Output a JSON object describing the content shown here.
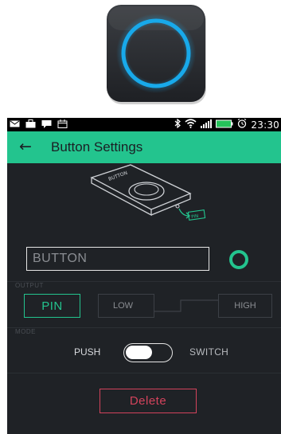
{
  "app_icon": {
    "icon": "blynk-button-ring-icon"
  },
  "status_bar": {
    "time": "23:30",
    "icons": [
      "email-icon",
      "briefcase-icon",
      "chat-icon",
      "calendar-icon",
      "bluetooth-icon",
      "wifi-icon",
      "signal-icon",
      "battery-icon",
      "alarm-icon"
    ]
  },
  "app_bar": {
    "back_icon": "←",
    "title": "Button Settings"
  },
  "preview": {
    "button_text": "BUTTON",
    "pin_text": "PIN"
  },
  "name_field": {
    "value": "BUTTON"
  },
  "output": {
    "label": "OUTPUT",
    "pin_button": "PIN",
    "low": "LOW",
    "high": "HIGH"
  },
  "mode": {
    "label": "MODE",
    "push": "PUSH",
    "switch": "SWITCH",
    "selected": "PUSH"
  },
  "delete_button": "Delete",
  "colors": {
    "accent": "#23c48e",
    "background": "#1f2226",
    "danger": "#d3435c",
    "icon_ring": "#1aa6e8"
  }
}
